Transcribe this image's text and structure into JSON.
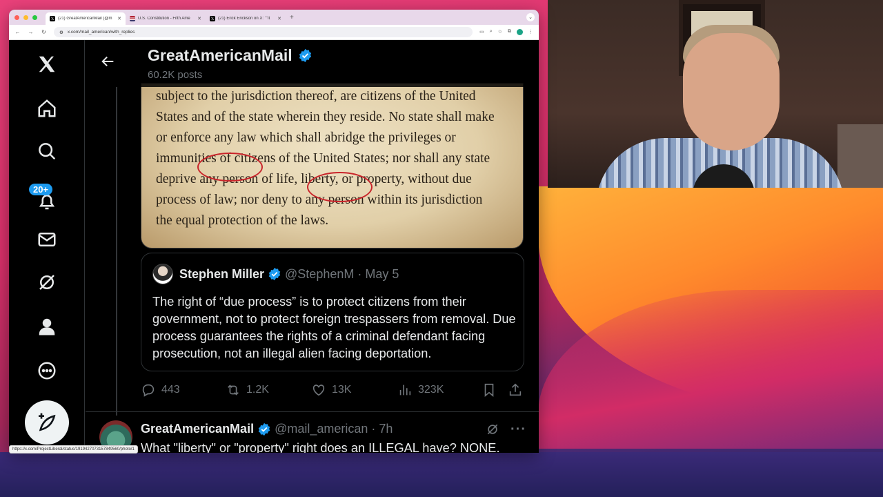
{
  "browser": {
    "tabs": [
      {
        "title": "(21) GreatAmericanMail (@m",
        "favicon": "x-logo",
        "active": true
      },
      {
        "title": "U.S. Constitution - Fifth Ame",
        "favicon": "flag-icon",
        "active": false
      },
      {
        "title": "(21) Erick Erickson on X: \"\"It",
        "favicon": "x-logo",
        "active": false
      }
    ],
    "new_tab": "+",
    "url": "x.com/mail_american/with_replies",
    "status_url": "https://x.com/ProjectLiberal/status/1919427073157849560/photo/1"
  },
  "nav": {
    "notifications_badge": "20+"
  },
  "profile_header": {
    "name": "GreatAmericanMail",
    "posts_count": "60.2K posts"
  },
  "document_image": {
    "lines": [
      "subject to the jurisdiction thereof, are citizens of the United",
      "States and of the state wherein they reside. No state shall make",
      "or enforce any law which shall abridge the privileges or",
      "immunities of citizens of the United States; nor shall any state",
      "deprive any person of life, liberty, or property, without due",
      "process of law; nor deny to any person within its jurisdiction",
      "the equal protection of the laws."
    ]
  },
  "quoted_post": {
    "name": "Stephen Miller",
    "handle": "@StephenM",
    "date": "· May 5",
    "text": "The right of “due process” is to protect citizens from their government, not to protect foreign trespassers from removal. Due process guarantees the rights of a criminal defendant facing prosecution, not an illegal alien facing deportation."
  },
  "actions": {
    "replies": "443",
    "reposts": "1.2K",
    "likes": "13K",
    "views": "323K"
  },
  "next_post": {
    "name": "GreatAmericanMail",
    "handle": "@mail_american",
    "time": "· 7h",
    "text": "What \"liberty\" or \"property\" right does an ILLEGAL have? NONE."
  },
  "colors": {
    "accent": "#1d9bf0",
    "background": "#000000",
    "text_primary": "#e7e9ea",
    "text_secondary": "#71767b",
    "highlight_circle": "#c9242a"
  }
}
